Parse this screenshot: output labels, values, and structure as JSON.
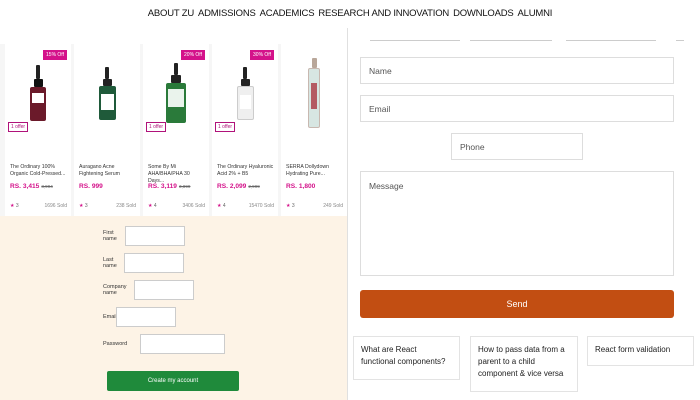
{
  "nav": {
    "items": [
      "ABOUT ZU",
      "ADMISSIONS",
      "ACADEMICS",
      "RESEARCH AND INNOVATION",
      "DOWNLOADS",
      "ALUMNI"
    ]
  },
  "products": [
    {
      "badge": "15% Off",
      "offer": "1 offer",
      "name": "The Ordinary 100% Organic Cold-Pressed...",
      "price": "RS. 3,415",
      "old_price": "3,994",
      "rating": "3",
      "sold": "1696 Sold",
      "color": "#6b1a2a"
    },
    {
      "badge": "",
      "offer": "",
      "name": "Auragano Acne Fightening Serum",
      "price": "RS. 999",
      "old_price": "",
      "rating": "3",
      "sold": "238 Sold",
      "color": "#1f5a3a"
    },
    {
      "badge": "20% Off",
      "offer": "1 offer",
      "name": "Some By Mi AHA/BHA/PHA 30 Days...",
      "price": "RS. 3,119",
      "old_price": "3,899",
      "rating": "4",
      "sold": "3406 Sold",
      "color": "#2a7a3a"
    },
    {
      "badge": "30% Off",
      "offer": "1 offer",
      "name": "The Ordinary Hyaluronic Acid 2% + B5",
      "price": "RS. 2,099",
      "old_price": "2,999",
      "rating": "4",
      "sold": "15470 Sold",
      "color": "#e8e8e8"
    },
    {
      "badge": "",
      "offer": "",
      "name": "SERRA Dollydown Hydrating Pure...",
      "price": "RS. 1,800",
      "old_price": "",
      "rating": "3",
      "sold": "249 Sold",
      "color": "#d7e6e2"
    }
  ],
  "signup": {
    "first_name": "First name",
    "last_name": "Last name",
    "company": "Company name",
    "email": "Email",
    "password": "Password",
    "button": "Create my account"
  },
  "contact": {
    "name_placeholder": "Name",
    "email_placeholder": "Email",
    "phone_placeholder": "Phone",
    "message_placeholder": "Message",
    "send": "Send"
  },
  "questions": [
    "What are React functional components?",
    "How to pass data from a parent to a child component & vice versa",
    "React form validation"
  ],
  "colors": {
    "accent": "#d4128a",
    "send": "#c24e12",
    "create": "#1f8a3b",
    "signup_bg": "#fdf3e6"
  }
}
